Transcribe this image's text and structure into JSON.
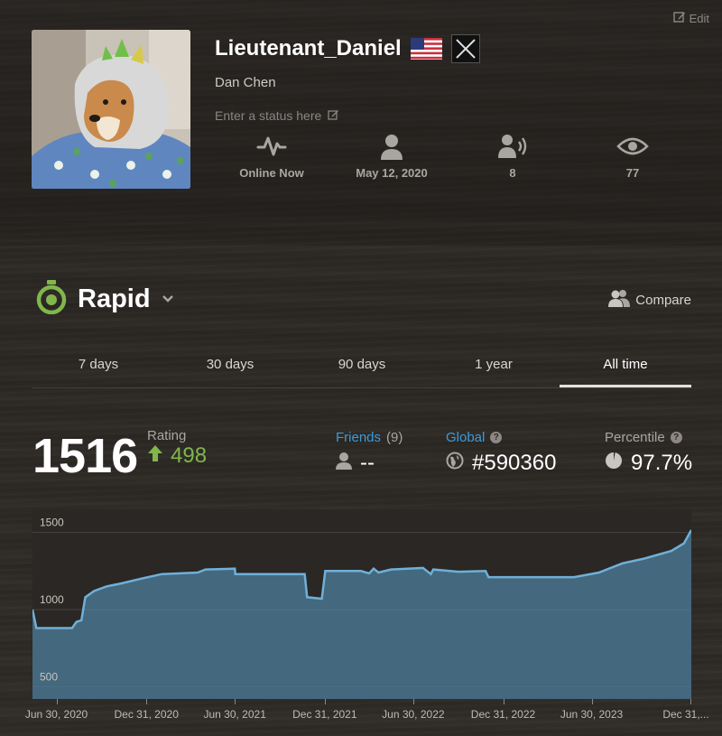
{
  "profile": {
    "edit_label": "Edit",
    "username": "Lieutenant_Daniel",
    "real_name": "Dan Chen",
    "status_placeholder": "Enter a status here",
    "stats": [
      {
        "icon": "activity-icon",
        "label": "Online Now"
      },
      {
        "icon": "person-icon",
        "label": "May 12, 2020"
      },
      {
        "icon": "followers-icon",
        "label": "8"
      },
      {
        "icon": "eye-icon",
        "label": "77"
      }
    ]
  },
  "game_mode": {
    "title": "Rapid",
    "compare_label": "Compare",
    "accent": "#81b64c"
  },
  "tabs": [
    "7 days",
    "30 days",
    "90 days",
    "1 year",
    "All time"
  ],
  "active_tab": "All time",
  "rating": {
    "value": "1516",
    "label": "Rating",
    "change": "498"
  },
  "friends": {
    "label": "Friends",
    "count": "(9)",
    "value": "--"
  },
  "global": {
    "label": "Global",
    "value": "#590360"
  },
  "percentile": {
    "label": "Percentile",
    "value": "97.7%"
  },
  "colors": {
    "blue_link": "#3b9bd9",
    "positive": "#81b64c",
    "chart_line": "#6fb0d8",
    "chart_fill": "#4d7f9c"
  },
  "chart_data": {
    "type": "area",
    "x_ticks": [
      "Jun 30, 2020",
      "Dec 31, 2020",
      "Jun 30, 2021",
      "Dec 31, 2021",
      "Jun 30, 2022",
      "Dec 31, 2022",
      "Jun 30, 2023",
      "Dec 31,..."
    ],
    "y_ticks": [
      500,
      1000,
      1500
    ],
    "ylim": [
      420,
      1650
    ],
    "xlim": [
      "2020-05-12",
      "2024-01-20"
    ],
    "grid": true,
    "series": [
      {
        "points": [
          [
            "2020-05-12",
            1000
          ],
          [
            "2020-05-20",
            880
          ],
          [
            "2020-07-15",
            880
          ],
          [
            "2020-08-01",
            880
          ],
          [
            "2020-08-10",
            920
          ],
          [
            "2020-08-20",
            930
          ],
          [
            "2020-08-28",
            1080
          ],
          [
            "2020-09-15",
            1120
          ],
          [
            "2020-10-10",
            1150
          ],
          [
            "2020-11-10",
            1170
          ],
          [
            "2020-12-20",
            1200
          ],
          [
            "2021-02-01",
            1230
          ],
          [
            "2021-04-15",
            1240
          ],
          [
            "2021-05-01",
            1260
          ],
          [
            "2021-06-30",
            1265
          ],
          [
            "2021-07-01",
            1230
          ],
          [
            "2021-11-20",
            1230
          ],
          [
            "2021-11-25",
            1080
          ],
          [
            "2021-12-25",
            1070
          ],
          [
            "2022-01-01",
            1250
          ],
          [
            "2022-03-15",
            1250
          ],
          [
            "2022-04-01",
            1235
          ],
          [
            "2022-04-10",
            1265
          ],
          [
            "2022-04-20",
            1240
          ],
          [
            "2022-05-15",
            1260
          ],
          [
            "2022-07-20",
            1270
          ],
          [
            "2022-08-05",
            1230
          ],
          [
            "2022-08-10",
            1260
          ],
          [
            "2022-10-01",
            1245
          ],
          [
            "2022-11-25",
            1250
          ],
          [
            "2022-12-01",
            1210
          ],
          [
            "2023-05-25",
            1210
          ],
          [
            "2023-07-15",
            1240
          ],
          [
            "2023-09-01",
            1300
          ],
          [
            "2023-10-15",
            1330
          ],
          [
            "2023-12-10",
            1380
          ],
          [
            "2024-01-05",
            1430
          ],
          [
            "2024-01-20",
            1516
          ]
        ]
      }
    ]
  }
}
